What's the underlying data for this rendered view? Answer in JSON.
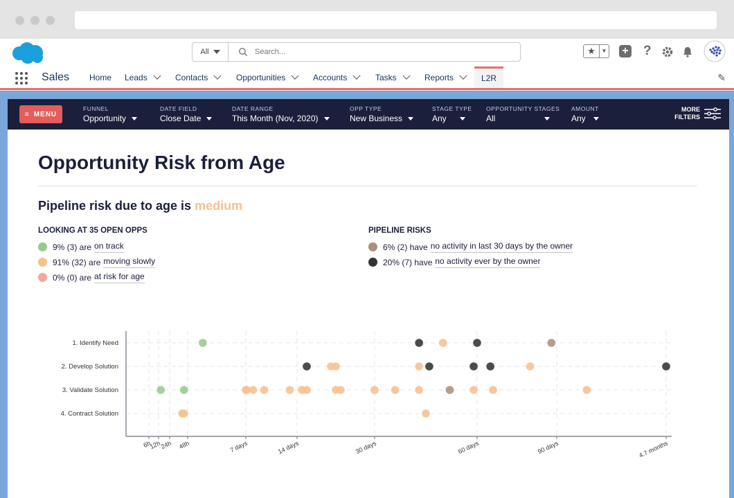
{
  "search": {
    "scope": "All",
    "placeholder": "Search..."
  },
  "app": {
    "name": "Sales"
  },
  "nav": [
    {
      "label": "Home",
      "dropdown": false
    },
    {
      "label": "Leads",
      "dropdown": true
    },
    {
      "label": "Contacts",
      "dropdown": true
    },
    {
      "label": "Opportunities",
      "dropdown": true
    },
    {
      "label": "Accounts",
      "dropdown": true
    },
    {
      "label": "Tasks",
      "dropdown": true
    },
    {
      "label": "Reports",
      "dropdown": true
    },
    {
      "label": "L2R",
      "dropdown": false,
      "active": true
    }
  ],
  "filters": {
    "menu_label": "MENU",
    "items": [
      {
        "label": "FUNNEL",
        "value": "Opportunity"
      },
      {
        "label": "DATE FIELD",
        "value": "Close Date"
      },
      {
        "label": "DATE RANGE",
        "value": "This Month (Nov, 2020)"
      },
      {
        "label": "OPP TYPE",
        "value": "New Business"
      },
      {
        "label": "STAGE TYPE",
        "value": "Any"
      },
      {
        "label": "OPPORTUNITY STAGES",
        "value": "All"
      },
      {
        "label": "AMOUNT",
        "value": "Any"
      }
    ],
    "more_line1": "MORE",
    "more_line2": "FILTERS"
  },
  "page": {
    "title": "Opportunity Risk from Age",
    "subtitle_prefix": "Pipeline risk due to age is",
    "subtitle_level": "medium"
  },
  "open_opps": {
    "heading": "LOOKING AT 35 OPEN OPPS",
    "rows": [
      {
        "stat": "9% (3) are",
        "link": "on track",
        "color": "#98c990"
      },
      {
        "stat": "91% (32) are",
        "link": "moving slowly",
        "color": "#f7c08d"
      },
      {
        "stat": "0% (0) are",
        "link": "at risk for age",
        "color": "#f3a6a0"
      }
    ]
  },
  "pipeline_risks": {
    "heading": "PIPELINE RISKS",
    "rows": [
      {
        "stat": "6% (2) have",
        "link": "no activity in last 30 days by the owner",
        "color": "#a89080"
      },
      {
        "stat": "20% (7) have",
        "link": "no activity ever by the owner",
        "color": "#333333"
      }
    ]
  },
  "colors": {
    "on_track": "#98c990",
    "moving_slowly": "#f7c08d",
    "at_risk": "#f3a6a0",
    "no_activity_30": "#a89080",
    "no_activity_ever": "#333333",
    "nav_accent": "#e87070",
    "filter_bar": "#1b1f3b",
    "menu_button": "#e35d5b"
  },
  "chart_data": {
    "type": "scatter",
    "x_scale": "nonlinear (age)",
    "categories": [
      "1. Identify Need",
      "2. Develop Solution",
      "3. Validate Solution",
      "4. Contract Solution"
    ],
    "x_ticks": [
      "6h",
      "12h",
      "24h",
      "48h",
      "7 days",
      "14 days",
      "30 days",
      "60 days",
      "90 days",
      "4.7 months"
    ],
    "grid": true,
    "points": [
      {
        "stage": "1. Identify Need",
        "age_days": 3.3,
        "status": "on_track"
      },
      {
        "stage": "1. Identify Need",
        "age_days": 43,
        "status": "no_activity_ever"
      },
      {
        "stage": "1. Identify Need",
        "age_days": 50,
        "status": "moving_slowly"
      },
      {
        "stage": "1. Identify Need",
        "age_days": 60,
        "status": "no_activity_ever"
      },
      {
        "stage": "1. Identify Need",
        "age_days": 88,
        "status": "no_activity_30"
      },
      {
        "stage": "2. Develop Solution",
        "age_days": 16,
        "status": "no_activity_ever"
      },
      {
        "stage": "2. Develop Solution",
        "age_days": 21,
        "status": "moving_slowly"
      },
      {
        "stage": "2. Develop Solution",
        "age_days": 22,
        "status": "moving_slowly"
      },
      {
        "stage": "2. Develop Solution",
        "age_days": 43,
        "status": "moving_slowly"
      },
      {
        "stage": "2. Develop Solution",
        "age_days": 46,
        "status": "no_activity_ever"
      },
      {
        "stage": "2. Develop Solution",
        "age_days": 59,
        "status": "no_activity_ever"
      },
      {
        "stage": "2. Develop Solution",
        "age_days": 65,
        "status": "no_activity_ever"
      },
      {
        "stage": "2. Develop Solution",
        "age_days": 80,
        "status": "moving_slowly"
      },
      {
        "stage": "2. Develop Solution",
        "age_days": 141,
        "status": "no_activity_ever"
      },
      {
        "stage": "3. Validate Solution",
        "age_days": 0.6,
        "status": "on_track"
      },
      {
        "stage": "3. Validate Solution",
        "age_days": 1.8,
        "status": "on_track"
      },
      {
        "stage": "3. Validate Solution",
        "age_days": 7,
        "status": "moving_slowly"
      },
      {
        "stage": "3. Validate Solution",
        "age_days": 7.1,
        "status": "moving_slowly"
      },
      {
        "stage": "3. Validate Solution",
        "age_days": 8,
        "status": "moving_slowly"
      },
      {
        "stage": "3. Validate Solution",
        "age_days": 9.5,
        "status": "moving_slowly"
      },
      {
        "stage": "3. Validate Solution",
        "age_days": 13,
        "status": "moving_slowly"
      },
      {
        "stage": "3. Validate Solution",
        "age_days": 15,
        "status": "moving_slowly"
      },
      {
        "stage": "3. Validate Solution",
        "age_days": 16,
        "status": "moving_slowly"
      },
      {
        "stage": "3. Validate Solution",
        "age_days": 22,
        "status": "moving_slowly"
      },
      {
        "stage": "3. Validate Solution",
        "age_days": 23,
        "status": "moving_slowly"
      },
      {
        "stage": "3. Validate Solution",
        "age_days": 30,
        "status": "moving_slowly"
      },
      {
        "stage": "3. Validate Solution",
        "age_days": 36,
        "status": "moving_slowly"
      },
      {
        "stage": "3. Validate Solution",
        "age_days": 43,
        "status": "moving_slowly"
      },
      {
        "stage": "3. Validate Solution",
        "age_days": 52,
        "status": "no_activity_30"
      },
      {
        "stage": "3. Validate Solution",
        "age_days": 59,
        "status": "moving_slowly"
      },
      {
        "stage": "3. Validate Solution",
        "age_days": 66,
        "status": "moving_slowly"
      },
      {
        "stage": "3. Validate Solution",
        "age_days": 104,
        "status": "moving_slowly"
      },
      {
        "stage": "4. Contract Solution",
        "age_days": 1.7,
        "status": "moving_slowly"
      },
      {
        "stage": "4. Contract Solution",
        "age_days": 1.8,
        "status": "moving_slowly"
      },
      {
        "stage": "4. Contract Solution",
        "age_days": 45,
        "status": "moving_slowly"
      }
    ]
  }
}
